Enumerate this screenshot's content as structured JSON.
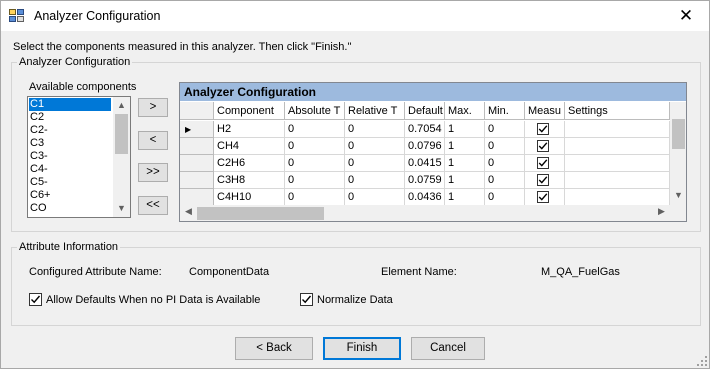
{
  "window": {
    "title": "Analyzer Configuration",
    "close_glyph": "✕"
  },
  "instruction": "Select the components measured in this analyzer. Then click \"Finish.\"",
  "config_group": {
    "title": "Analyzer Configuration"
  },
  "available": {
    "label": "Available components",
    "items": [
      "C1",
      "C2",
      "C2-",
      "C3",
      "C3-",
      "C4-",
      "C5-",
      "C6+",
      "CO"
    ],
    "selected_index": 0
  },
  "move_buttons": {
    "add": ">",
    "remove": "<",
    "add_all": ">>",
    "remove_all": "<<"
  },
  "grid": {
    "caption": "Analyzer Configuration",
    "columns": [
      "Component",
      "Absolute T",
      "Relative T",
      "Default",
      "Max.",
      "Min.",
      "Measu",
      "Settings"
    ],
    "rows": [
      {
        "component": "H2",
        "absolute": "0",
        "relative": "0",
        "default": "0.7054",
        "max": "1",
        "min": "0",
        "measured": true,
        "settings": ""
      },
      {
        "component": "CH4",
        "absolute": "0",
        "relative": "0",
        "default": "0.0796",
        "max": "1",
        "min": "0",
        "measured": true,
        "settings": ""
      },
      {
        "component": "C2H6",
        "absolute": "0",
        "relative": "0",
        "default": "0.0415",
        "max": "1",
        "min": "0",
        "measured": true,
        "settings": ""
      },
      {
        "component": "C3H8",
        "absolute": "0",
        "relative": "0",
        "default": "0.0759",
        "max": "1",
        "min": "0",
        "measured": true,
        "settings": ""
      },
      {
        "component": "C4H10",
        "absolute": "0",
        "relative": "0",
        "default": "0.0436",
        "max": "1",
        "min": "0",
        "measured": true,
        "settings": ""
      }
    ],
    "current_row_glyph": "▶"
  },
  "attribute_group": {
    "title": "Attribute Information",
    "configured_attribute_label": "Configured Attribute Name:",
    "configured_attribute_value": "ComponentData",
    "element_name_label": "Element Name:",
    "element_name_value": "M_QA_FuelGas",
    "allow_defaults": {
      "label": "Allow Defaults When no PI Data is Available",
      "checked": true
    },
    "normalize": {
      "label": "Normalize Data",
      "checked": true
    }
  },
  "footer": {
    "back": "< Back",
    "finish": "Finish",
    "cancel": "Cancel"
  },
  "colors": {
    "selection": "#0078d7",
    "grid_caption": "#9dbade",
    "default_button_border": "#0078d7"
  }
}
